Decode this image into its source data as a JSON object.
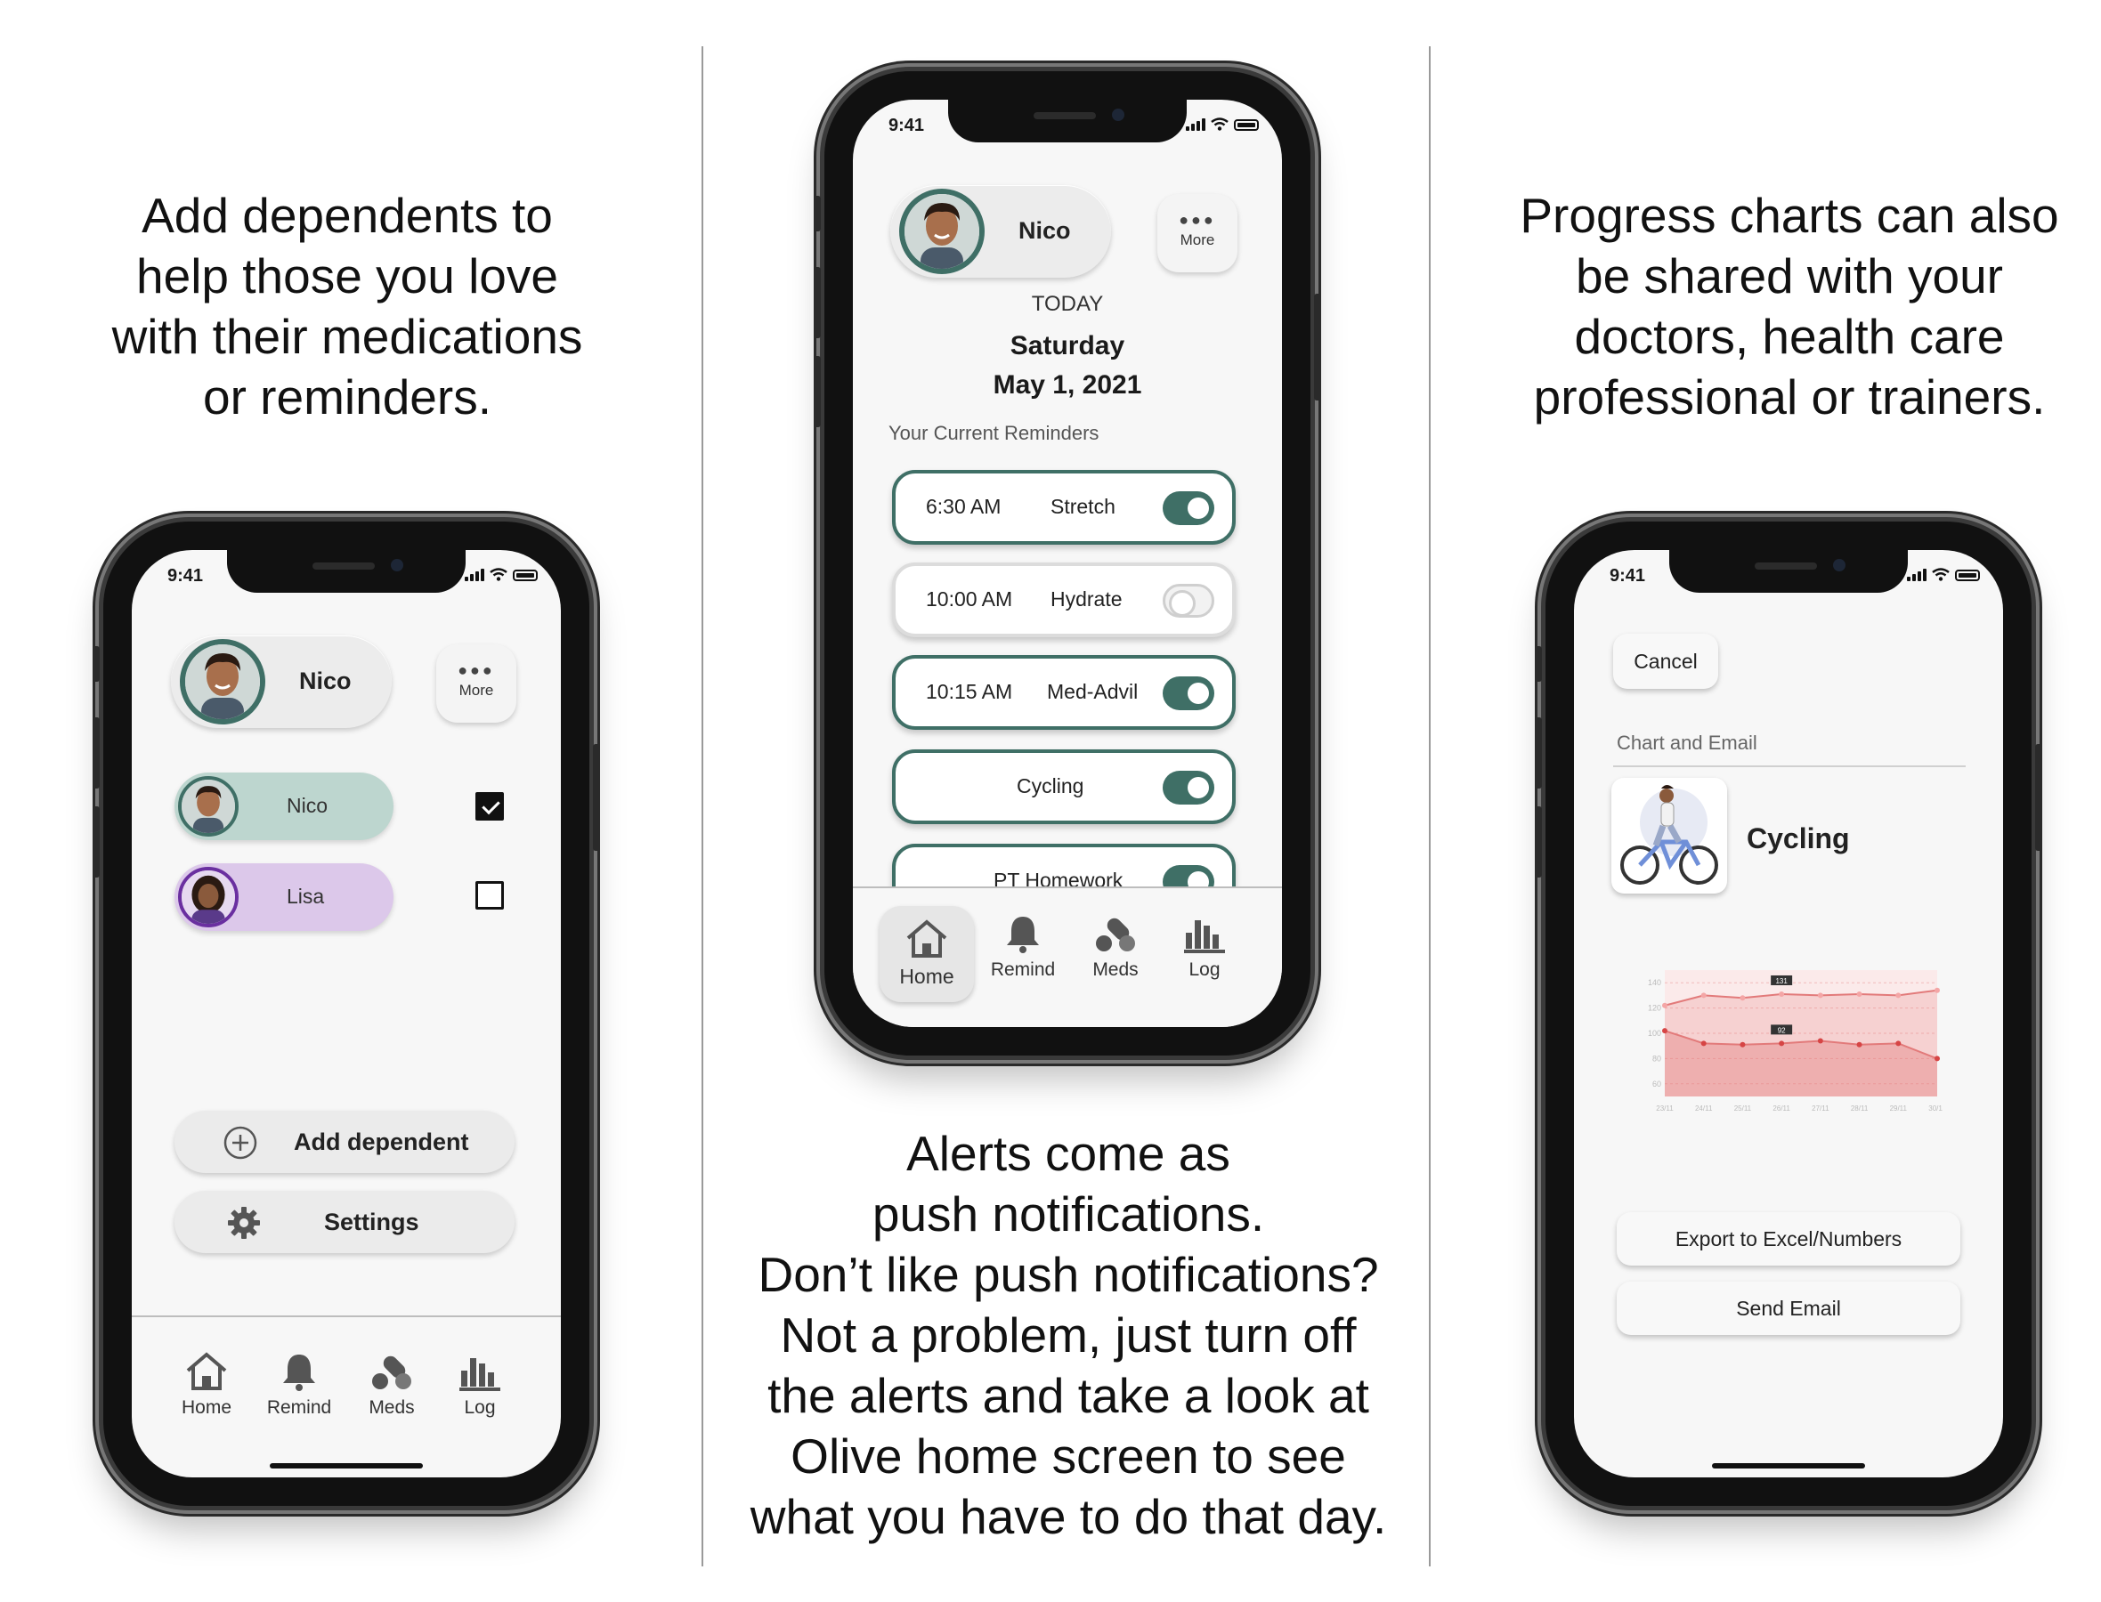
{
  "captions": {
    "left": "Add dependents to\nhelp those you love\nwith their medications\nor reminders.",
    "middle": "Alerts come as\npush notifications.\nDon’t like push notifications?\nNot a problem, just turn off\nthe alerts and take a look at\nOlive home screen to see\nwhat you have to do that day.",
    "right": "Progress charts can also\nbe shared with your\ndoctors, health care\nprofessional or trainers."
  },
  "status_time": "9:41",
  "profile": {
    "name": "Nico",
    "more_label": "More"
  },
  "tabs": [
    {
      "label": "Home",
      "icon": "home-icon"
    },
    {
      "label": "Remind",
      "icon": "bell-icon"
    },
    {
      "label": "Meds",
      "icon": "pills-icon"
    },
    {
      "label": "Log",
      "icon": "bar-chart-icon"
    }
  ],
  "left_phone": {
    "dependents": [
      {
        "name": "Nico",
        "checked": true,
        "color": "#bdd6cf"
      },
      {
        "name": "Lisa",
        "checked": false,
        "color": "#dcc8ea"
      }
    ],
    "add_dependent": "Add dependent",
    "settings": "Settings"
  },
  "middle_phone": {
    "today": "TODAY",
    "day": "Saturday",
    "date": "May 1, 2021",
    "reminders_title": "Your Current Reminders",
    "reminders": [
      {
        "time": "6:30 AM",
        "task": "Stretch",
        "on": true
      },
      {
        "time": "10:00 AM",
        "task": "Hydrate",
        "on": false
      },
      {
        "time": "10:15 AM",
        "task": "Med-Advil",
        "on": true
      },
      {
        "time": "",
        "task": "Cycling",
        "on": true
      },
      {
        "time": "",
        "task": "PT Homework",
        "on": true
      }
    ]
  },
  "right_phone": {
    "cancel": "Cancel",
    "section_label": "Chart and Email",
    "activity": "Cycling",
    "export": "Export to Excel/Numbers",
    "send_email": "Send Email",
    "accent": "#e27a7a"
  },
  "chart_data": {
    "type": "area",
    "title": "",
    "xlabel": "",
    "ylabel": "",
    "ylim": [
      50,
      150
    ],
    "yticks": [
      140,
      120,
      100,
      80,
      60
    ],
    "categories": [
      "23/11",
      "24/11",
      "25/11",
      "26/11",
      "27/11",
      "28/11",
      "29/11",
      "30/11"
    ],
    "series": [
      {
        "values": [
          122,
          130,
          128,
          131,
          130,
          131,
          130,
          134
        ]
      },
      {
        "values": [
          102,
          92,
          91,
          92,
          94,
          91,
          92,
          80
        ]
      }
    ],
    "annotations": [
      "131",
      "92"
    ]
  }
}
